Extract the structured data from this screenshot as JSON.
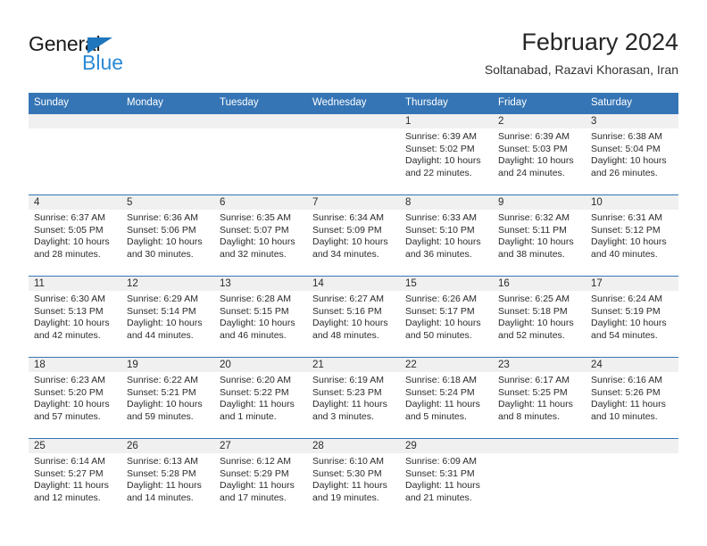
{
  "brand": {
    "name_top": "General",
    "name_bottom": "Blue",
    "triangle_icon": "triangle-icon",
    "accent_dark": "#1f76bd",
    "accent_light": "#2b8ad6"
  },
  "header": {
    "title": "February 2024",
    "subtitle": "Soltanabad, Razavi Khorasan, Iran"
  },
  "colors": {
    "header_blue": "#3575b5",
    "day_band_gray": "#f0f0f0",
    "text": "#2b2b2b"
  },
  "weekdays": [
    "Sunday",
    "Monday",
    "Tuesday",
    "Wednesday",
    "Thursday",
    "Friday",
    "Saturday"
  ],
  "weeks": [
    [
      {
        "day": "",
        "sunrise": "",
        "sunset": "",
        "daylight_line1": "",
        "daylight_line2": ""
      },
      {
        "day": "",
        "sunrise": "",
        "sunset": "",
        "daylight_line1": "",
        "daylight_line2": ""
      },
      {
        "day": "",
        "sunrise": "",
        "sunset": "",
        "daylight_line1": "",
        "daylight_line2": ""
      },
      {
        "day": "",
        "sunrise": "",
        "sunset": "",
        "daylight_line1": "",
        "daylight_line2": ""
      },
      {
        "day": "1",
        "sunrise": "Sunrise: 6:39 AM",
        "sunset": "Sunset: 5:02 PM",
        "daylight_line1": "Daylight: 10 hours",
        "daylight_line2": "and 22 minutes."
      },
      {
        "day": "2",
        "sunrise": "Sunrise: 6:39 AM",
        "sunset": "Sunset: 5:03 PM",
        "daylight_line1": "Daylight: 10 hours",
        "daylight_line2": "and 24 minutes."
      },
      {
        "day": "3",
        "sunrise": "Sunrise: 6:38 AM",
        "sunset": "Sunset: 5:04 PM",
        "daylight_line1": "Daylight: 10 hours",
        "daylight_line2": "and 26 minutes."
      }
    ],
    [
      {
        "day": "4",
        "sunrise": "Sunrise: 6:37 AM",
        "sunset": "Sunset: 5:05 PM",
        "daylight_line1": "Daylight: 10 hours",
        "daylight_line2": "and 28 minutes."
      },
      {
        "day": "5",
        "sunrise": "Sunrise: 6:36 AM",
        "sunset": "Sunset: 5:06 PM",
        "daylight_line1": "Daylight: 10 hours",
        "daylight_line2": "and 30 minutes."
      },
      {
        "day": "6",
        "sunrise": "Sunrise: 6:35 AM",
        "sunset": "Sunset: 5:07 PM",
        "daylight_line1": "Daylight: 10 hours",
        "daylight_line2": "and 32 minutes."
      },
      {
        "day": "7",
        "sunrise": "Sunrise: 6:34 AM",
        "sunset": "Sunset: 5:09 PM",
        "daylight_line1": "Daylight: 10 hours",
        "daylight_line2": "and 34 minutes."
      },
      {
        "day": "8",
        "sunrise": "Sunrise: 6:33 AM",
        "sunset": "Sunset: 5:10 PM",
        "daylight_line1": "Daylight: 10 hours",
        "daylight_line2": "and 36 minutes."
      },
      {
        "day": "9",
        "sunrise": "Sunrise: 6:32 AM",
        "sunset": "Sunset: 5:11 PM",
        "daylight_line1": "Daylight: 10 hours",
        "daylight_line2": "and 38 minutes."
      },
      {
        "day": "10",
        "sunrise": "Sunrise: 6:31 AM",
        "sunset": "Sunset: 5:12 PM",
        "daylight_line1": "Daylight: 10 hours",
        "daylight_line2": "and 40 minutes."
      }
    ],
    [
      {
        "day": "11",
        "sunrise": "Sunrise: 6:30 AM",
        "sunset": "Sunset: 5:13 PM",
        "daylight_line1": "Daylight: 10 hours",
        "daylight_line2": "and 42 minutes."
      },
      {
        "day": "12",
        "sunrise": "Sunrise: 6:29 AM",
        "sunset": "Sunset: 5:14 PM",
        "daylight_line1": "Daylight: 10 hours",
        "daylight_line2": "and 44 minutes."
      },
      {
        "day": "13",
        "sunrise": "Sunrise: 6:28 AM",
        "sunset": "Sunset: 5:15 PM",
        "daylight_line1": "Daylight: 10 hours",
        "daylight_line2": "and 46 minutes."
      },
      {
        "day": "14",
        "sunrise": "Sunrise: 6:27 AM",
        "sunset": "Sunset: 5:16 PM",
        "daylight_line1": "Daylight: 10 hours",
        "daylight_line2": "and 48 minutes."
      },
      {
        "day": "15",
        "sunrise": "Sunrise: 6:26 AM",
        "sunset": "Sunset: 5:17 PM",
        "daylight_line1": "Daylight: 10 hours",
        "daylight_line2": "and 50 minutes."
      },
      {
        "day": "16",
        "sunrise": "Sunrise: 6:25 AM",
        "sunset": "Sunset: 5:18 PM",
        "daylight_line1": "Daylight: 10 hours",
        "daylight_line2": "and 52 minutes."
      },
      {
        "day": "17",
        "sunrise": "Sunrise: 6:24 AM",
        "sunset": "Sunset: 5:19 PM",
        "daylight_line1": "Daylight: 10 hours",
        "daylight_line2": "and 54 minutes."
      }
    ],
    [
      {
        "day": "18",
        "sunrise": "Sunrise: 6:23 AM",
        "sunset": "Sunset: 5:20 PM",
        "daylight_line1": "Daylight: 10 hours",
        "daylight_line2": "and 57 minutes."
      },
      {
        "day": "19",
        "sunrise": "Sunrise: 6:22 AM",
        "sunset": "Sunset: 5:21 PM",
        "daylight_line1": "Daylight: 10 hours",
        "daylight_line2": "and 59 minutes."
      },
      {
        "day": "20",
        "sunrise": "Sunrise: 6:20 AM",
        "sunset": "Sunset: 5:22 PM",
        "daylight_line1": "Daylight: 11 hours",
        "daylight_line2": "and 1 minute."
      },
      {
        "day": "21",
        "sunrise": "Sunrise: 6:19 AM",
        "sunset": "Sunset: 5:23 PM",
        "daylight_line1": "Daylight: 11 hours",
        "daylight_line2": "and 3 minutes."
      },
      {
        "day": "22",
        "sunrise": "Sunrise: 6:18 AM",
        "sunset": "Sunset: 5:24 PM",
        "daylight_line1": "Daylight: 11 hours",
        "daylight_line2": "and 5 minutes."
      },
      {
        "day": "23",
        "sunrise": "Sunrise: 6:17 AM",
        "sunset": "Sunset: 5:25 PM",
        "daylight_line1": "Daylight: 11 hours",
        "daylight_line2": "and 8 minutes."
      },
      {
        "day": "24",
        "sunrise": "Sunrise: 6:16 AM",
        "sunset": "Sunset: 5:26 PM",
        "daylight_line1": "Daylight: 11 hours",
        "daylight_line2": "and 10 minutes."
      }
    ],
    [
      {
        "day": "25",
        "sunrise": "Sunrise: 6:14 AM",
        "sunset": "Sunset: 5:27 PM",
        "daylight_line1": "Daylight: 11 hours",
        "daylight_line2": "and 12 minutes."
      },
      {
        "day": "26",
        "sunrise": "Sunrise: 6:13 AM",
        "sunset": "Sunset: 5:28 PM",
        "daylight_line1": "Daylight: 11 hours",
        "daylight_line2": "and 14 minutes."
      },
      {
        "day": "27",
        "sunrise": "Sunrise: 6:12 AM",
        "sunset": "Sunset: 5:29 PM",
        "daylight_line1": "Daylight: 11 hours",
        "daylight_line2": "and 17 minutes."
      },
      {
        "day": "28",
        "sunrise": "Sunrise: 6:10 AM",
        "sunset": "Sunset: 5:30 PM",
        "daylight_line1": "Daylight: 11 hours",
        "daylight_line2": "and 19 minutes."
      },
      {
        "day": "29",
        "sunrise": "Sunrise: 6:09 AM",
        "sunset": "Sunset: 5:31 PM",
        "daylight_line1": "Daylight: 11 hours",
        "daylight_line2": "and 21 minutes."
      },
      {
        "day": "",
        "sunrise": "",
        "sunset": "",
        "daylight_line1": "",
        "daylight_line2": ""
      },
      {
        "day": "",
        "sunrise": "",
        "sunset": "",
        "daylight_line1": "",
        "daylight_line2": ""
      }
    ]
  ]
}
